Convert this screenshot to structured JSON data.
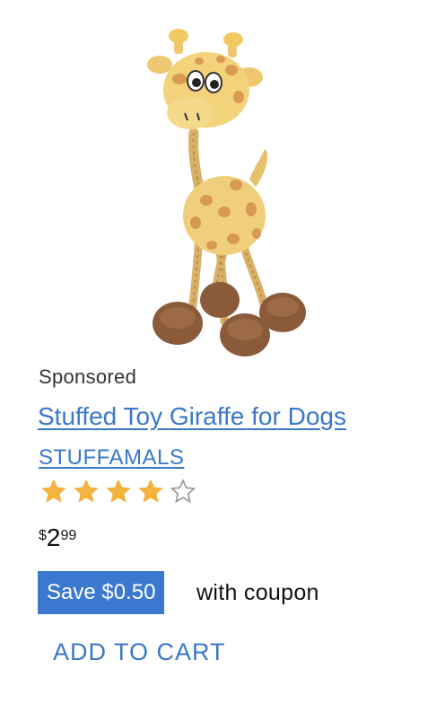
{
  "product": {
    "image_alt": "giraffe plush toy",
    "sponsored_label": "Sponsored",
    "title": "Stuffed Toy Giraffe for Dogs",
    "brand": "STUFFAMALS",
    "rating": 4,
    "rating_max": 5,
    "price": {
      "symbol": "$",
      "dollars": "2",
      "cents": "99"
    },
    "coupon": {
      "badge": "Save $0.50",
      "text": "with coupon"
    },
    "add_to_cart_label": "ADD TO CART"
  },
  "colors": {
    "link": "#3a78c9",
    "coupon_bg": "#3b78d0",
    "star_filled": "#f4b23e",
    "star_empty": "#9a9a9a"
  },
  "icons": {
    "star_filled": "star-icon",
    "star_empty": "star-outline-icon"
  }
}
